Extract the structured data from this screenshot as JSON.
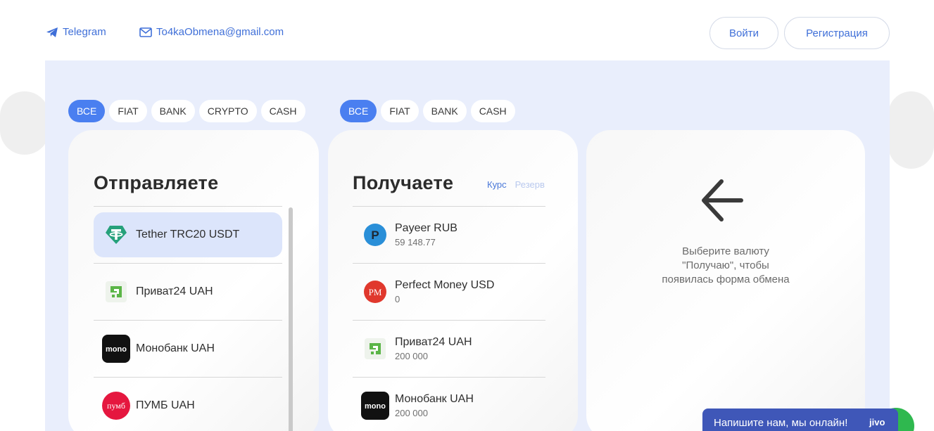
{
  "header": {
    "telegram_label": "Telegram",
    "email_label": "To4kaObmena@gmail.com",
    "login_label": "Войти",
    "register_label": "Регистрация"
  },
  "send_filters": [
    "ВСЕ",
    "FIAT",
    "BANK",
    "CRYPTO",
    "CASH"
  ],
  "receive_filters": [
    "ВСЕ",
    "FIAT",
    "BANK",
    "CASH"
  ],
  "send_panel": {
    "title": "Отправляете",
    "items": [
      {
        "name": "Tether TRC20 USDT",
        "icon": "tether-icon",
        "selected": true
      },
      {
        "name": "Приват24 UAH",
        "icon": "privat24-icon",
        "selected": false
      },
      {
        "name": "Монобанк UAH",
        "icon": "monobank-icon",
        "selected": false
      },
      {
        "name": "ПУМБ UAH",
        "icon": "pumb-icon",
        "selected": false
      }
    ]
  },
  "receive_panel": {
    "title": "Получаете",
    "rate_tab": "Курс",
    "reserve_tab": "Резерв",
    "items": [
      {
        "name": "Payeer RUB",
        "amount": "59 148.77",
        "icon": "payeer-icon"
      },
      {
        "name": "Perfect Money USD",
        "amount": "0",
        "icon": "perfect-money-icon"
      },
      {
        "name": "Приват24 UAH",
        "amount": "200 000",
        "icon": "privat24-icon"
      },
      {
        "name": "Монобанк UAH",
        "amount": "200 000",
        "icon": "monobank-icon"
      }
    ]
  },
  "form_panel": {
    "hint_line1": "Выберите валюту",
    "hint_line2": "\"Получаю\", чтобы",
    "hint_line3": "появилась форма обмена",
    "icon": "arrow-left-icon"
  },
  "chat": {
    "label": "Напишите нам, мы онлайн!",
    "brand": "jivo"
  },
  "icon_text": {
    "mono": "mono",
    "pumb": "пумб",
    "payeer": "P",
    "perfect_money": "PM"
  },
  "colors": {
    "accent": "#4a7ff0",
    "link": "#3f6fd8",
    "panel_bg": "#e9eefc",
    "selected_item": "#dce5fb",
    "chat_bg": "#3f57b8",
    "tether": "#26a17b",
    "privat": "#5bb547",
    "pumb": "#e5173f",
    "payeer": "#2a8fd8",
    "perfect_money": "#e0382d"
  }
}
